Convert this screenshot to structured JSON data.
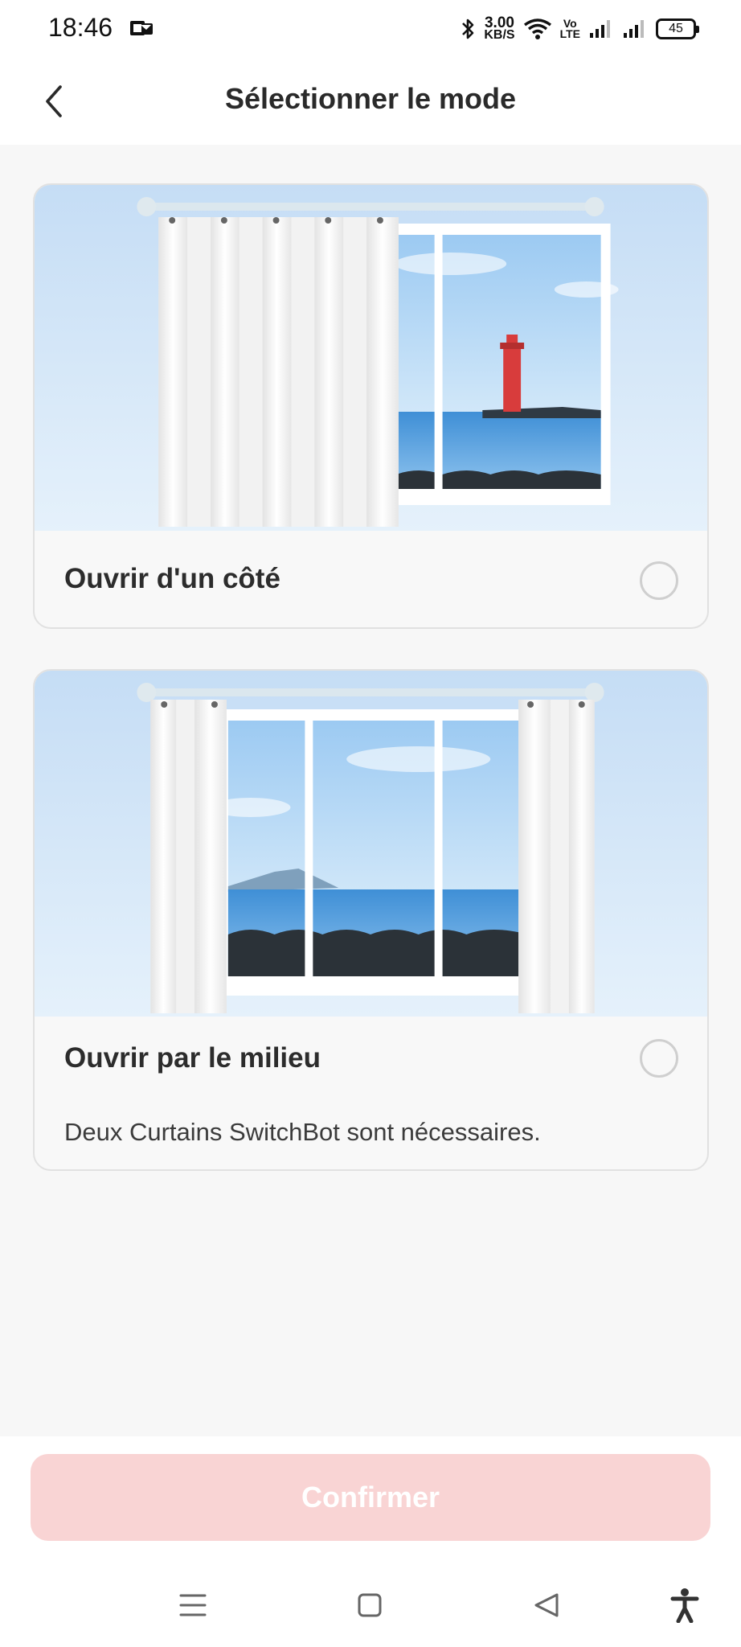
{
  "status_bar": {
    "time": "18:46",
    "speed_value": "3.00",
    "speed_unit": "KB/S",
    "volte_top": "Vo",
    "volte_bottom": "LTE",
    "battery": "45"
  },
  "header": {
    "title": "Sélectionner le mode",
    "back_icon": "chevron-left-icon"
  },
  "options": [
    {
      "title": "Ouvrir d'un côté",
      "description": "",
      "selected": false,
      "illustration": "single-curtain-illustration"
    },
    {
      "title": "Ouvrir par le milieu",
      "description": "Deux Curtains SwitchBot sont nécessaires.",
      "selected": false,
      "illustration": "double-curtain-illustration"
    }
  ],
  "confirm_button": {
    "label": "Confirmer",
    "enabled": false,
    "color": "#f9d4d4"
  },
  "nav_bar": {
    "icons": [
      "menu-icon",
      "home-square-icon",
      "back-triangle-icon",
      "accessibility-icon"
    ]
  }
}
